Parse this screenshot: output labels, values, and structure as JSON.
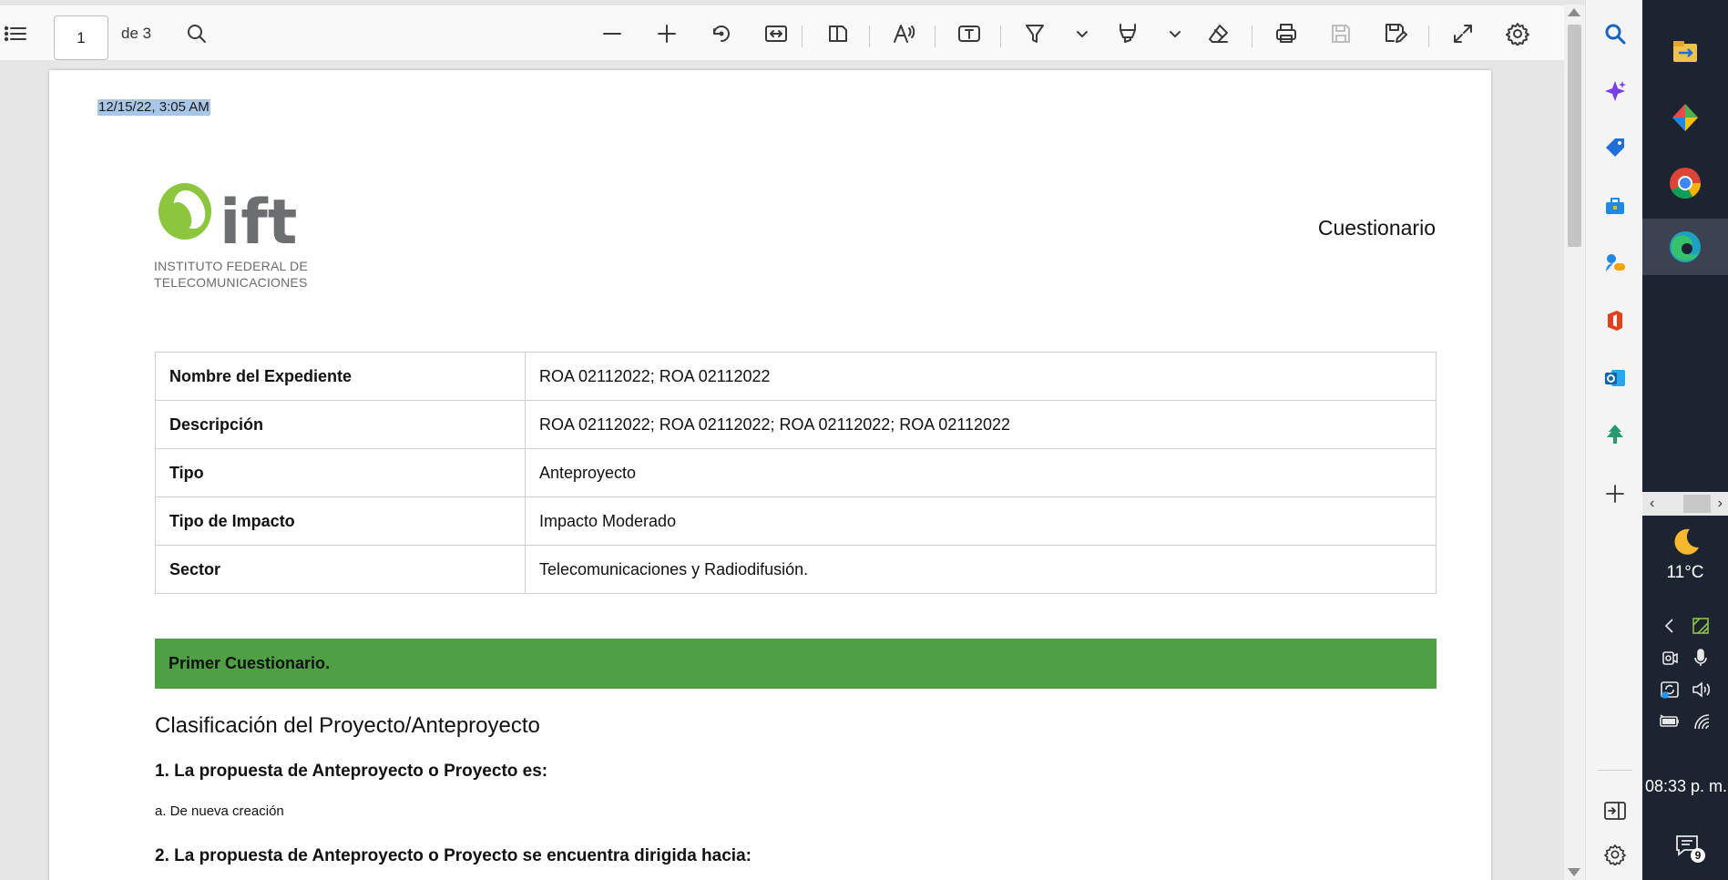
{
  "toolbar": {
    "page_number": "1",
    "page_of": "de 3",
    "icons": [
      "contents-icon",
      "search-icon",
      "zoom-out-icon",
      "zoom-in-icon",
      "rotate-icon",
      "fit-width-icon",
      "page-view-icon",
      "read-aloud-icon",
      "text-box-icon",
      "draw-icon",
      "highlight-icon",
      "erase-icon",
      "print-icon",
      "save-icon",
      "save-as-icon",
      "fullscreen-icon",
      "settings-icon"
    ]
  },
  "document": {
    "timestamp": "12/15/22, 3:05 AM",
    "logo_name": "ift",
    "logo_sub_line1": "INSTITUTO FEDERAL DE",
    "logo_sub_line2": "TELECOMUNICACIONES",
    "title": "Cuestionario",
    "info_rows": [
      {
        "key": "Nombre del Expediente",
        "value": "ROA 02112022; ROA 02112022"
      },
      {
        "key": "Descripción",
        "value": "ROA 02112022; ROA 02112022; ROA 02112022; ROA 02112022"
      },
      {
        "key": "Tipo",
        "value": "Anteproyecto"
      },
      {
        "key": "Tipo de Impacto",
        "value": "Impacto Moderado"
      },
      {
        "key": "Sector",
        "value": "Telecomunicaciones y Radiodifusión."
      }
    ],
    "section_bar": "Primer Cuestionario.",
    "section_heading": "Clasificación del Proyecto/Anteproyecto",
    "q1": "1. La propuesta de Anteproyecto o Proyecto es:",
    "a1": "a. De nueva creación",
    "q2": "2. La propuesta de Anteproyecto o Proyecto se encuentra dirigida hacia:"
  },
  "colors": {
    "green_bar": "#4f9f45",
    "selection": "#a8c7e6",
    "taskbar": "#1c2331",
    "logo_green": "#8cc63f",
    "logo_gray": "#6d6e70"
  },
  "edge_sidebar": {
    "icons": [
      "search-icon",
      "copilot-icon",
      "shopping-icon",
      "tools-icon",
      "games-icon",
      "office-icon",
      "outlook-icon",
      "tree-icon",
      "add-icon",
      "hide-sidebar-icon",
      "settings-icon"
    ]
  },
  "taskbar": {
    "temperature": "11°C",
    "clock": "08:33 p. m.",
    "notifications": "9",
    "apps": [
      "file-explorer-icon",
      "paint-icon",
      "chrome-icon",
      "edge-icon"
    ]
  }
}
